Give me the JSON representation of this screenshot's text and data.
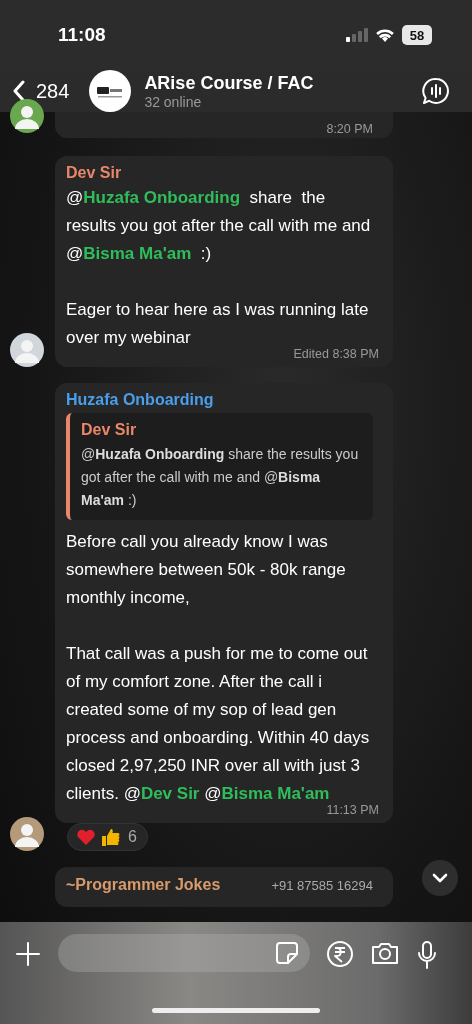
{
  "status_bar": {
    "time": "11:08",
    "battery": "58"
  },
  "header": {
    "back_count": "284",
    "title": "ARise Course / FAC",
    "subtitle": "32 online"
  },
  "messages": [
    {
      "kind": "cut",
      "time": "8:20 PM"
    },
    {
      "kind": "text",
      "sender": "Dev Sir",
      "color": "#e8876a",
      "text": "@**Huzafa Onboarding**  share  the results you got after the call with me and @**Bisma Ma'am**  :)\n\nEager to hear here as I was running late over my webinar",
      "time": "Edited 8:38 PM"
    },
    {
      "kind": "reply",
      "sender": "Huzafa Onboarding",
      "color": "#4a9eea",
      "quote": {
        "sender": "Dev Sir",
        "color": "#e8876a",
        "text": "@**Huzafa Onboarding**  share  the results you got after the call with me and @**Bisma Ma'am**  :)"
      },
      "text": "Before call you already know I was somewhere between 50k - 80k range monthly income,\n\nThat call was a push for me to come out of my comfort zone. After the call i created some of my sop of lead gen process and onboarding. Within 40 days closed 2,97,250 INR over all with just 3 clients. @**Dev Sir** @**Bisma Ma'am**",
      "time": "11:13 PM",
      "reactions": {
        "count": "6"
      }
    },
    {
      "kind": "header_only",
      "sender": "~Programmer Jokes",
      "color": "#d99a6c",
      "phone": "+91 87585 16294"
    }
  ]
}
